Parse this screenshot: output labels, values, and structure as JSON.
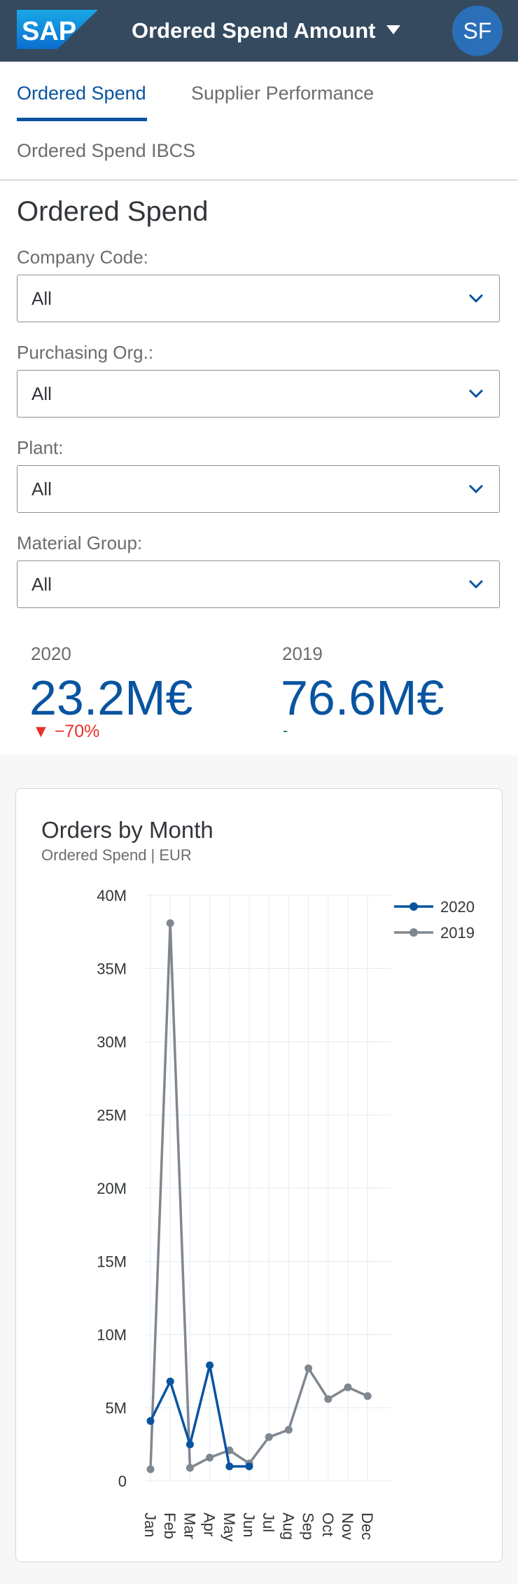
{
  "brand": {
    "logo_text": "SAP",
    "logo_color": "#0a6ed1"
  },
  "shell": {
    "title": "Ordered Spend Amount",
    "avatar_initials": "SF",
    "bar_color": "#354a5f"
  },
  "tabs": [
    {
      "label": "Ordered Spend",
      "selected": true
    },
    {
      "label": "Supplier Performance",
      "selected": false
    },
    {
      "label": "Ordered Spend IBCS",
      "selected": false
    }
  ],
  "page": {
    "title": "Ordered Spend"
  },
  "filters": [
    {
      "label": "Company Code:",
      "value": "All"
    },
    {
      "label": "Purchasing Org.:",
      "value": "All"
    },
    {
      "label": "Plant:",
      "value": "All"
    },
    {
      "label": "Material Group:",
      "value": "All"
    }
  ],
  "kpis": [
    {
      "year": "2020",
      "value": "23.2M€",
      "delta": "▼ −70%",
      "delta_color": "#e9302b"
    },
    {
      "year": "2019",
      "value": "76.6M€",
      "delta": "-",
      "delta_color": "#107e3e"
    }
  ],
  "card": {
    "title": "Orders by Month",
    "subtitle": "Ordered Spend | EUR"
  },
  "chart_data": {
    "type": "line",
    "title": "Orders by Month",
    "subtitle": "Ordered Spend | EUR",
    "categories": [
      "Jan",
      "Feb",
      "Mar",
      "Apr",
      "May",
      "Jun",
      "Jul",
      "Aug",
      "Sep",
      "Oct",
      "Nov",
      "Dec"
    ],
    "ylim": [
      0,
      40000000
    ],
    "yticks": [
      "0",
      "5M",
      "10M",
      "15M",
      "20M",
      "25M",
      "30M",
      "35M",
      "40M"
    ],
    "grid": true,
    "legend": "top-right",
    "series": [
      {
        "name": "2020",
        "color": "#0854a0",
        "values": [
          4100000,
          6800000,
          2500000,
          7900000,
          1000000,
          1000000,
          null,
          null,
          null,
          null,
          null,
          null
        ]
      },
      {
        "name": "2019",
        "color": "#7f878f",
        "values": [
          800000,
          38100000,
          900000,
          1600000,
          2100000,
          1200000,
          3000000,
          3500000,
          7700000,
          5600000,
          6400000,
          5800000
        ]
      }
    ]
  }
}
